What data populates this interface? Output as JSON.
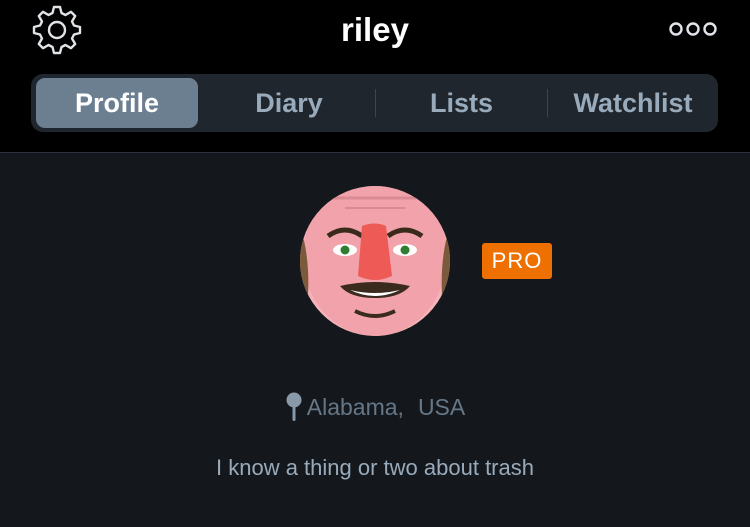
{
  "header": {
    "title": "riley",
    "settings_icon": "gear-icon",
    "more_icon": "more-dots-icon"
  },
  "tabs": [
    {
      "label": "Profile",
      "active": true
    },
    {
      "label": "Diary",
      "active": false
    },
    {
      "label": "Lists",
      "active": false
    },
    {
      "label": "Watchlist",
      "active": false
    }
  ],
  "profile": {
    "badge": "PRO",
    "location": {
      "icon": "map-pin-icon",
      "region": "Alabama",
      "separator": ",",
      "country": "USA"
    },
    "bio": "I know a thing or two about trash"
  },
  "colors": {
    "background": "#14181c",
    "header_background": "#000000",
    "tab_bar": "#1f262e",
    "tab_active": "#6b7f91",
    "pro_badge": "#ee7000"
  }
}
